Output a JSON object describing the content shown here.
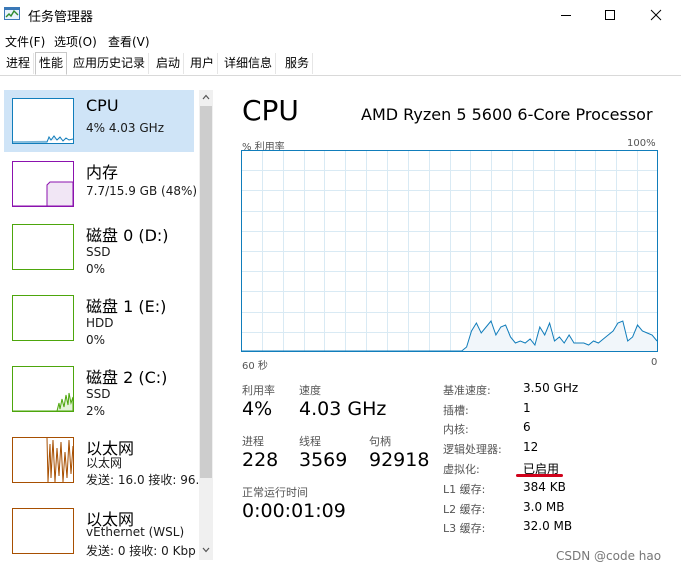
{
  "window": {
    "title": "任务管理器",
    "minimize_icon": "minimize-icon",
    "maximize_icon": "maximize-icon",
    "close_icon": "close-icon"
  },
  "menu": {
    "items": [
      "文件(F)",
      "选项(O)",
      "查看(V)"
    ]
  },
  "tabs": [
    "进程",
    "性能",
    "应用历史记录",
    "启动",
    "用户",
    "详细信息",
    "服务"
  ],
  "active_tab": "性能",
  "sidebar": {
    "items": [
      {
        "title": "CPU",
        "line1": "4% 4.03 GHz",
        "line2": ""
      },
      {
        "title": "内存",
        "line1": "7.7/15.9 GB (48%)",
        "line2": ""
      },
      {
        "title": "磁盘 0 (D:)",
        "line1": "SSD",
        "line2": "0%"
      },
      {
        "title": "磁盘 1 (E:)",
        "line1": "HDD",
        "line2": "0%"
      },
      {
        "title": "磁盘 2 (C:)",
        "line1": "SSD",
        "line2": "2%"
      },
      {
        "title": "以太网",
        "line1": "以太网",
        "line2": "发送: 16.0 接收: 96."
      },
      {
        "title": "以太网",
        "line1": "vEthernet (WSL)",
        "line2": "发送: 0 接收: 0 Kbp"
      }
    ],
    "thumb_colors": [
      "#117dbb",
      "#8b12ae",
      "#4da60c",
      "#4da60c",
      "#4da60c",
      "#a74f01",
      "#a74f01"
    ]
  },
  "main": {
    "heading": "CPU",
    "model": "AMD Ryzen 5 5600 6-Core Processor",
    "graph_label_left": "% 利用率",
    "graph_label_right": "100%",
    "axis_left": "60 秒",
    "axis_right": "0",
    "utilization_label": "利用率",
    "utilization_value": "4%",
    "speed_label": "速度",
    "speed_value": "4.03 GHz",
    "processes_label": "进程",
    "processes_value": "228",
    "threads_label": "线程",
    "threads_value": "3569",
    "handles_label": "句柄",
    "handles_value": "92918",
    "uptime_label": "正常运行时间",
    "uptime_value": "0:00:01:09",
    "details": [
      {
        "label": "基准速度:",
        "value": "3.50 GHz"
      },
      {
        "label": "插槽:",
        "value": "1"
      },
      {
        "label": "内核:",
        "value": "6"
      },
      {
        "label": "逻辑处理器:",
        "value": "12"
      },
      {
        "label": "虚拟化:",
        "value": "已启用"
      },
      {
        "label": "L1 缓存:",
        "value": "384 KB"
      },
      {
        "label": "L2 缓存:",
        "value": "3.0 MB"
      },
      {
        "label": "L3 缓存:",
        "value": "32.0 MB"
      }
    ]
  },
  "cpu_history_percent": [
    0,
    0,
    0,
    0,
    0,
    0,
    0,
    0,
    0,
    0,
    0,
    0,
    0,
    0,
    0,
    0,
    0,
    0,
    0,
    0,
    0,
    0,
    0,
    0,
    0,
    0,
    0,
    0,
    0,
    0,
    0,
    0,
    0,
    0,
    0,
    0,
    0,
    0,
    0,
    0,
    0,
    0,
    0,
    0,
    0,
    0,
    2,
    10,
    14,
    9,
    12,
    15,
    8,
    12,
    13,
    7,
    4,
    5,
    4,
    6,
    3,
    12,
    8,
    14,
    5,
    7,
    4,
    8,
    4,
    4,
    4,
    3,
    5,
    4,
    6,
    8,
    10,
    14,
    15,
    5,
    7,
    13,
    10,
    9,
    8,
    5
  ],
  "colors": {
    "cpu_accent": "#117dbb",
    "graph_fill": "#f1f6fa",
    "graph_grid": "#d9eaf4",
    "selected_bg": "#cfe4f7",
    "underline_red": "#d0021b"
  },
  "watermark": "CSDN @code hao"
}
